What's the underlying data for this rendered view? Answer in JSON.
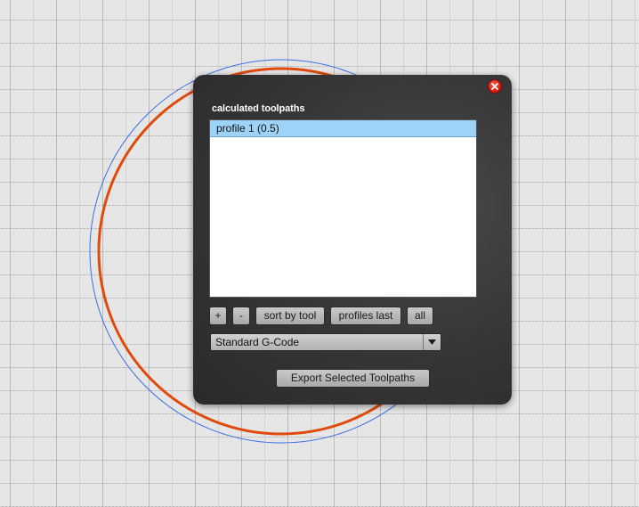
{
  "canvas": {
    "colors": {
      "background": "#e6e6e6",
      "part_outline": "#3a6fe0",
      "toolpath": "#e04a0c"
    }
  },
  "dialog": {
    "title": "calculated toolpaths",
    "close_icon": "close-icon",
    "toolpaths": [
      {
        "label": "profile 1 (0.5)",
        "selected": true
      }
    ],
    "buttons": {
      "add": "+",
      "remove": "-",
      "sort_by_tool": "sort by tool",
      "profiles_last": "profiles last",
      "all": "all"
    },
    "format_select": {
      "value": "Standard G-Code",
      "arrow_icon": "chevron-down-icon"
    },
    "export_button": "Export Selected Toolpaths"
  }
}
